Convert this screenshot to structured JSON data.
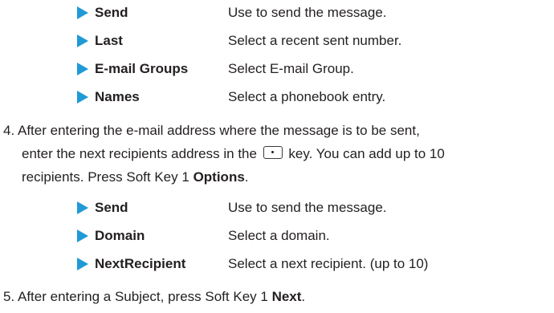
{
  "options_a": [
    {
      "term": "Send",
      "desc": "Use to send the message."
    },
    {
      "term": "Last",
      "desc": "Select a recent sent number."
    },
    {
      "term": "E-mail Groups",
      "desc": "Select E-mail Group."
    },
    {
      "term": "Names",
      "desc": "Select a phonebook entry."
    }
  ],
  "step4": {
    "num": "4.",
    "line1": "After entering the e-mail address where the message is to be sent,",
    "line2_a": "enter the next recipients address in the",
    "key_icon": "ok-key-icon",
    "line2_b": "key. You can add up to 10",
    "line3_a": "recipients. Press Soft Key 1",
    "line3_bold": "Options",
    "line3_end": "."
  },
  "options_b": [
    {
      "term": "Send",
      "desc": "Use to send the message."
    },
    {
      "term": "Domain",
      "desc": "Select a domain."
    },
    {
      "term": "NextRecipient",
      "desc": "Select a next recipient. (up to 10)"
    }
  ],
  "step5": {
    "num": "5.",
    "text": "After entering a Subject, press Soft Key 1",
    "bold": "Next",
    "end": "."
  },
  "colors": {
    "arrow": "#1f9ad6",
    "text": "#231f20"
  }
}
